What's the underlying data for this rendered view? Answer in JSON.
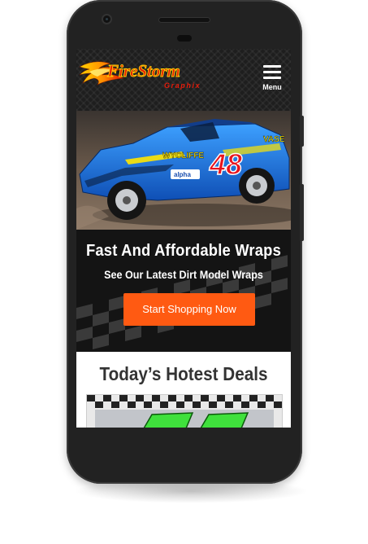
{
  "header": {
    "logo_text_main": "FireStorm",
    "logo_text_sub": "Graphix",
    "menu_label": "Menu"
  },
  "hero_image": {
    "car_number": "48",
    "sponsor_name": "WYCLIFFE",
    "sponsor_badge": "alpha",
    "sponsor_right": "VASE"
  },
  "hero": {
    "title": "Fast And Affordable Wraps",
    "subtitle": "See Our Latest Dirt Model Wraps",
    "cta_label": "Start Shopping Now"
  },
  "deals": {
    "title": "Today’s Hotest Deals"
  },
  "colors": {
    "accent": "#ff5a12",
    "phone_body": "#222222",
    "header_bg": "#1e1e1e",
    "car_blue": "#1a6fe0",
    "deal_green": "#3fe03c"
  }
}
